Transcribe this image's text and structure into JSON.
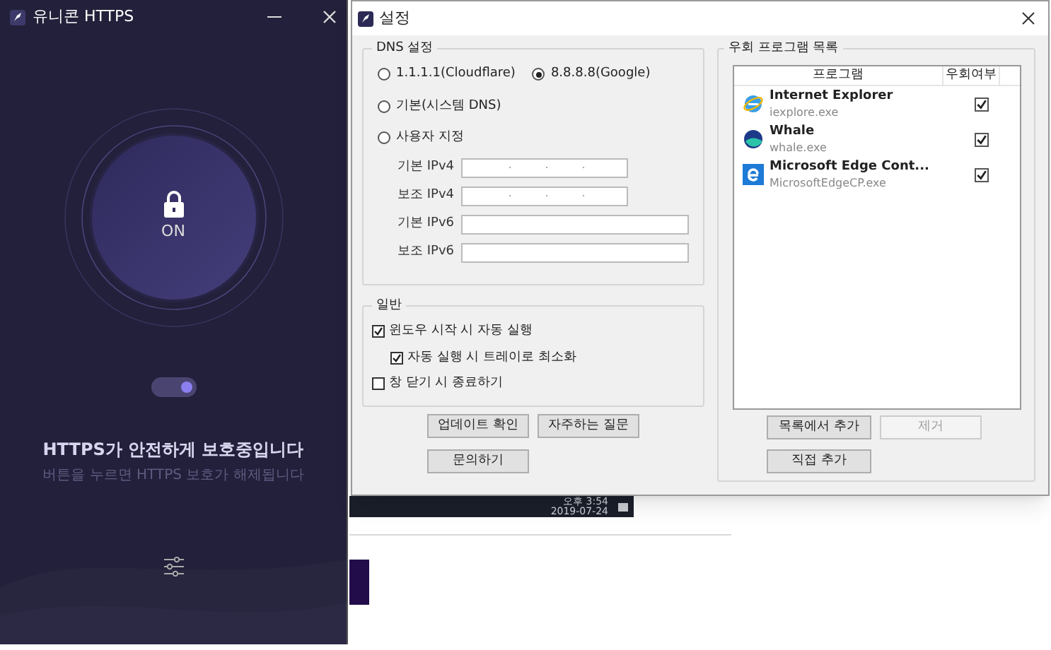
{
  "app_window": {
    "title": "유니콘 HTTPS",
    "lock_label": "ON",
    "toggle": {
      "on": true
    },
    "status_title": "HTTPS가 안전하게 보호중입니다",
    "status_hint": "버튼을 누르면 HTTPS 보호가 해제됩니다"
  },
  "settings_window": {
    "title": "설정",
    "dns": {
      "title": "DNS 설정",
      "options": [
        {
          "label": "1.1.1.1(Cloudflare)",
          "selected": false
        },
        {
          "label": "8.8.8.8(Google)",
          "selected": true
        },
        {
          "label": "기본(시스템 DNS)",
          "selected": false
        },
        {
          "label": "사용자 지정",
          "selected": false
        }
      ],
      "fields": [
        {
          "label": "기본 IPv4",
          "kind": "ipv4"
        },
        {
          "label": "보조 IPv4",
          "kind": "ipv4"
        },
        {
          "label": "기본 IPv6",
          "kind": "ipv6"
        },
        {
          "label": "보조 IPv6",
          "kind": "ipv6"
        }
      ]
    },
    "general": {
      "title": "일반",
      "options": [
        {
          "label": "윈도우 시작 시 자동 실행",
          "checked": true,
          "children": [
            {
              "label": "자동 실행 시 트레이로 최소화",
              "checked": true
            }
          ]
        },
        {
          "label": "창 닫기 시 종료하기",
          "checked": false
        }
      ]
    },
    "buttons": [
      {
        "label": "업데이트 확인"
      },
      {
        "label": "자주하는 질문"
      },
      {
        "label": "문의하기"
      }
    ],
    "bypass": {
      "title": "우회 프로그램 목록",
      "columns": [
        "프로그램",
        "우회여부"
      ],
      "rows": [
        {
          "kind": "ie",
          "name": "Internet Explorer",
          "exe": "iexplore.exe",
          "checked": true
        },
        {
          "kind": "whale",
          "name": "Whale",
          "exe": "whale.exe",
          "checked": true
        },
        {
          "kind": "edge",
          "name": "Microsoft Edge Cont...",
          "exe": "MicrosoftEdgeCP.exe",
          "checked": true
        }
      ],
      "buttons": [
        {
          "label": "목록에서 추가",
          "disabled": false
        },
        {
          "label": "제거",
          "disabled": true
        },
        {
          "label": "직접 추가",
          "disabled": false
        }
      ]
    }
  },
  "taskbar": {
    "time": "오후 3:54",
    "date": "2019-07-24"
  }
}
